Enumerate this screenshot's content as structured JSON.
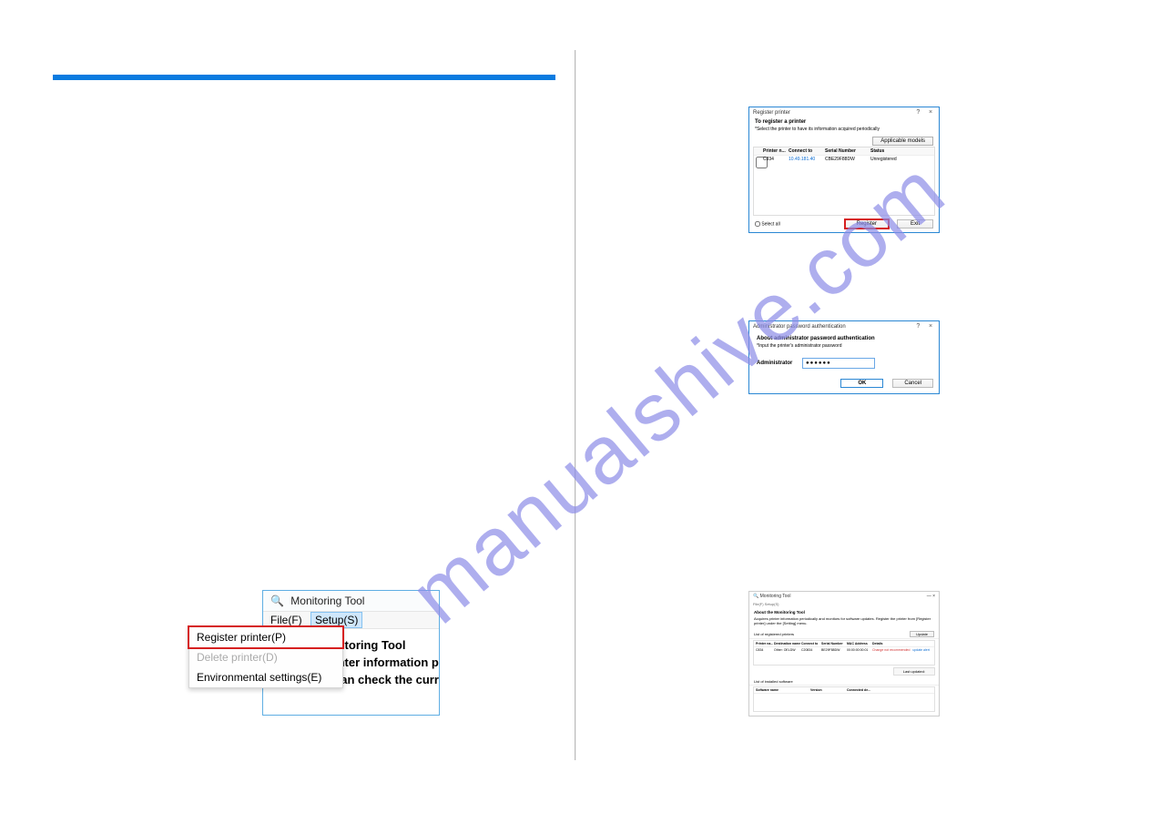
{
  "watermark": "manualshive.com",
  "fig1": {
    "window_title": "Monitoring Tool",
    "menu_file": "File(F)",
    "menu_setup": "Setup(S)",
    "dropdown": {
      "register": "Register printer(P)",
      "delete": "Delete printer(D)",
      "env": "Environmental settings(E)"
    },
    "body_line1": "nitoring Tool",
    "body_line2": "inter information perio",
    "body_line3": "can check the current s"
  },
  "fig2": {
    "title": "Register printer",
    "help_icon": "?",
    "close_icon": "×",
    "heading": "To register a printer",
    "sub": "*Select the printer to have its information acquired periodically",
    "applicable_btn": "Applicable models",
    "columns": {
      "name": "Printer n...",
      "conn": "Connect to",
      "sn": "Serial Number",
      "stat": "Status"
    },
    "row": {
      "name": "C834",
      "conn": "10.49.181.40",
      "sn": "CBE29F88DW",
      "stat": "Unregistered"
    },
    "select_all": "Select all",
    "register_btn": "Register",
    "exit_btn": "Exit"
  },
  "fig3": {
    "title": "Administrator password authentication",
    "help_icon": "?",
    "close_icon": "×",
    "heading": "About administrator password authentication",
    "sub": "*Input the printer's administrator password",
    "label": "Administrator",
    "value_masked": "●●●●●●",
    "ok": "OK",
    "cancel": "Cancel"
  },
  "fig4": {
    "title": "Monitoring Tool",
    "winicons": "— ×",
    "menu": "File(F)   Setup(S)",
    "desc_bold": "About the Monitoring Tool",
    "desc_text": "Acquires printer information periodically and monitors for software updates. Register the printer from [Register printer] under the [Setting] menu.",
    "section1": "List of registered printers",
    "update_btn": "Update",
    "cols": {
      "c1": "Printer na...",
      "c2": "Destination name",
      "c3": "Connect to",
      "c4": "Serial Number",
      "c5": "MAC Address",
      "c6": "Details"
    },
    "row": {
      "c1": "C834",
      "c2": "Other: OELDW",
      "c3": "C20834",
      "c4": "BE29F88DW",
      "c5": "00:00:00:00:01",
      "err": "Change not recommended",
      "link": "update alert"
    },
    "lastupd": "Last updated:",
    "section2": "List of installed software",
    "cols2": {
      "a": "Software name",
      "b": "Version",
      "c": "Connected de..."
    }
  }
}
